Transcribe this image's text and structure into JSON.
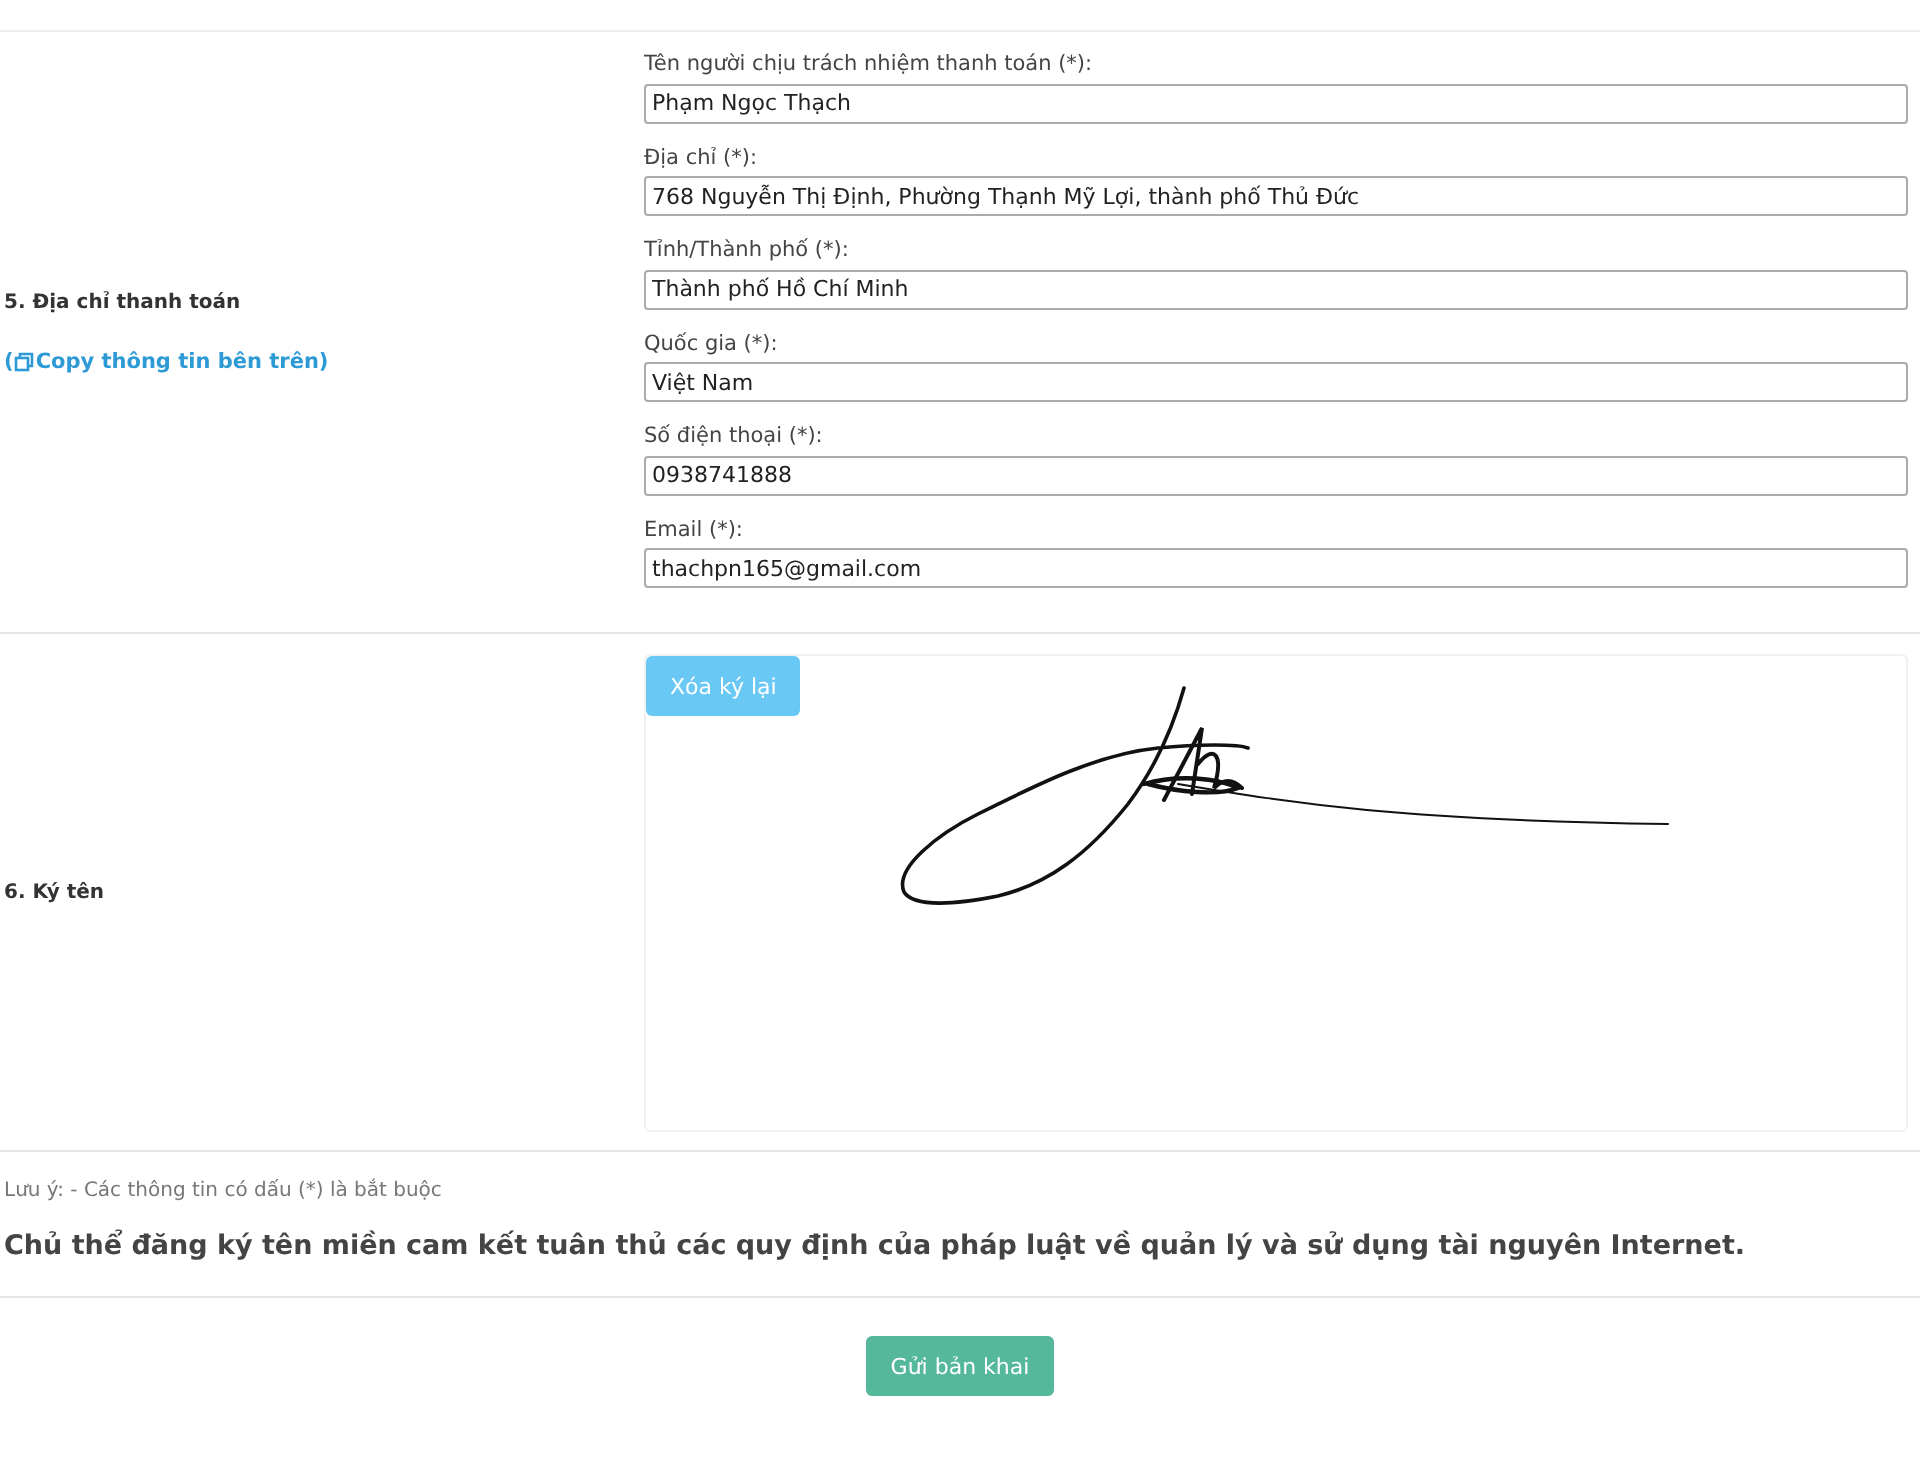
{
  "billing_section": {
    "title": "5. Địa chỉ thanh toán",
    "copy_link": "( ",
    "copy_link_text": "Copy thông tin bên trên)",
    "fields": [
      {
        "label": "Tên người chịu trách nhiệm thanh toán (*):",
        "value": "Phạm Ngọc Thạch"
      },
      {
        "label": "Địa chỉ (*):",
        "value": "768 Nguyễn Thị Định, Phường Thạnh Mỹ Lợi, thành phố Thủ Đức"
      },
      {
        "label": "Tỉnh/Thành phố (*):",
        "value": "Thành phố Hồ Chí Minh"
      },
      {
        "label": "Quốc gia (*):",
        "value": "Việt Nam"
      },
      {
        "label": "Số điện thoại (*):",
        "value": "0938741888"
      },
      {
        "label": "Email (*):",
        "value": "thachpn165@gmail.com"
      }
    ]
  },
  "signature_section": {
    "title": "6. Ký tên",
    "clear_button": "Xóa ký lại"
  },
  "note": "Lưu ý: - Các thông tin có dấu (*) là bắt buộc",
  "commitment": "Chủ thể đăng ký tên miền cam kết tuân thủ các quy định của pháp luật về quản lý và sử dụng tài nguyên Internet.",
  "submit_button": "Gửi bản khai"
}
